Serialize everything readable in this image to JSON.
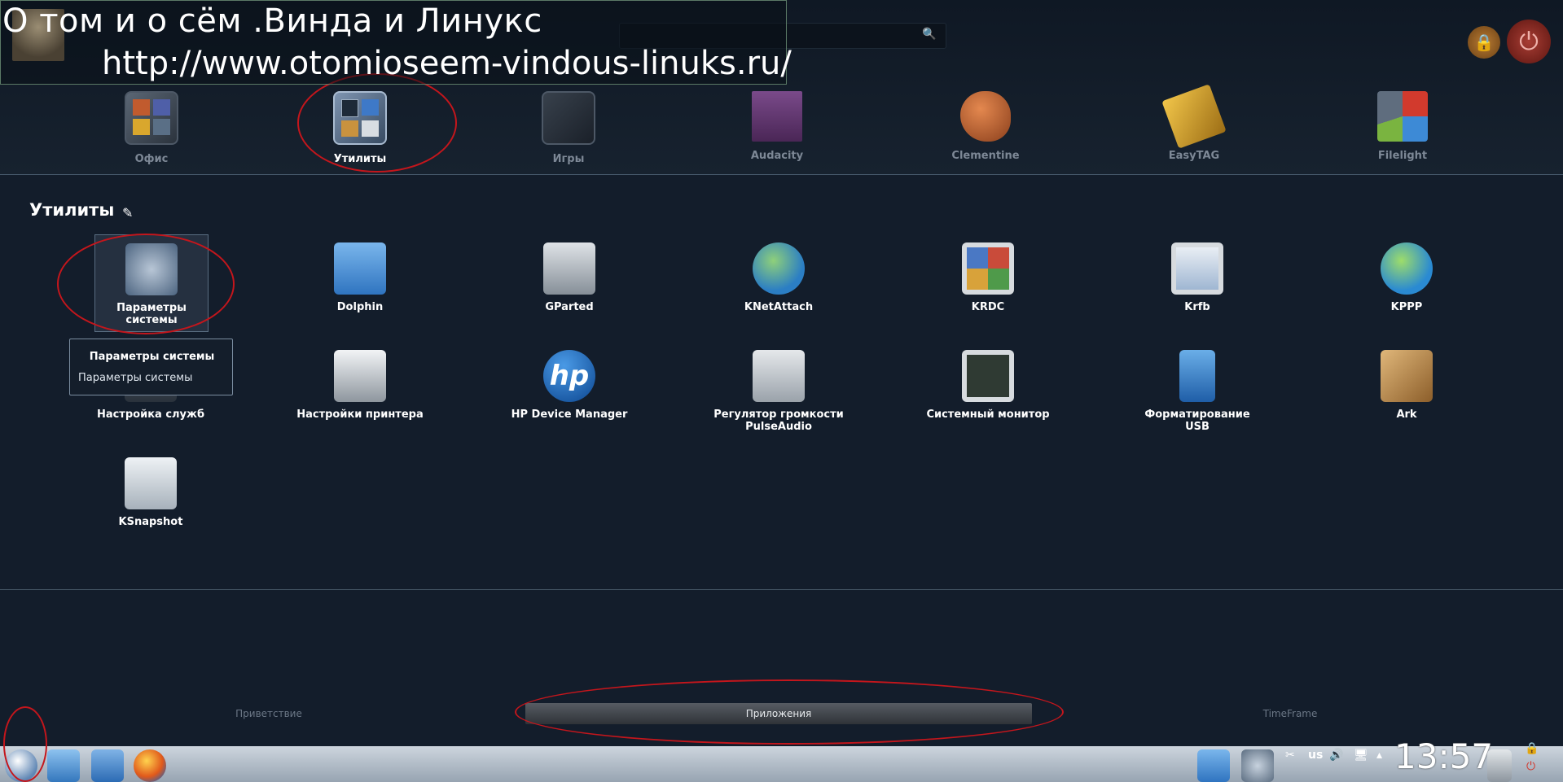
{
  "watermark": {
    "title": "О том и о сём .Винда и Линукс",
    "url": "http://www.otomioseem-vindous-linuks.ru/"
  },
  "favorites": [
    {
      "label": "Офис",
      "icon": "office-icon",
      "color": "#7a5a3a"
    },
    {
      "label": "Утилиты",
      "icon": "utilities-icon",
      "color": "#6d87a6",
      "active": true
    },
    {
      "label": "Игры",
      "icon": "games-icon",
      "color": "#333a44"
    },
    {
      "label": "Audacity",
      "icon": "audacity-icon",
      "color": "#6a3d78"
    },
    {
      "label": "Clementine",
      "icon": "clementine-icon",
      "color": "#c2693b"
    },
    {
      "label": "EasyTAG",
      "icon": "easytag-icon",
      "color": "#d6a52b"
    },
    {
      "label": "Filelight",
      "icon": "filelight-icon",
      "color": "#5f6d7e"
    }
  ],
  "section": {
    "title": "Утилиты"
  },
  "apps": [
    {
      "label": "Параметры системы",
      "icon": "system-settings-icon",
      "color": "#7d96b5"
    },
    {
      "label": "Dolphin",
      "icon": "dolphin-folder-icon",
      "color": "#4b91d6"
    },
    {
      "label": "GParted",
      "icon": "gparted-disk-icon",
      "color": "#b9c0c6"
    },
    {
      "label": "KNetAttach",
      "icon": "globe-network-icon",
      "color": "#4aa0d8"
    },
    {
      "label": "KRDC",
      "icon": "krdc-monitor-icon",
      "color": "#d2d6da"
    },
    {
      "label": "Krfb",
      "icon": "krfb-desktop-icon",
      "color": "#d2d6da"
    },
    {
      "label": "KPPP",
      "icon": "kppp-globe-icon",
      "color": "#3d9bd8"
    },
    {
      "label": "Настройка служб",
      "icon": "services-icon",
      "color": "#5c6b7a"
    },
    {
      "label": "Настройки принтера",
      "icon": "printer-icon",
      "color": "#d9dde1"
    },
    {
      "label": "HP Device Manager",
      "icon": "hp-icon",
      "color": "#1f66b4"
    },
    {
      "label": "Регулятор громкости PulseAudio",
      "icon": "mixer-icon",
      "color": "#c8ced4"
    },
    {
      "label": "Системный монитор",
      "icon": "system-monitor-icon",
      "color": "#cfd4d8"
    },
    {
      "label": "Форматирование USB",
      "icon": "usb-icon",
      "color": "#3d7fc4"
    },
    {
      "label": "Ark",
      "icon": "ark-box-icon",
      "color": "#c99a55"
    },
    {
      "label": "KSnapshot",
      "icon": "camera-icon",
      "color": "#cfd6dd"
    }
  ],
  "tooltip": {
    "title": "Параметры системы",
    "text": "Параметры системы"
  },
  "tabs": [
    "Приветствие",
    "Приложения",
    "TimeFrame"
  ],
  "panel": {
    "clock": "13:57",
    "keyboard_layout": "us"
  },
  "colors": {
    "accent_annotation": "#c4161c",
    "background": "#131d2b"
  }
}
